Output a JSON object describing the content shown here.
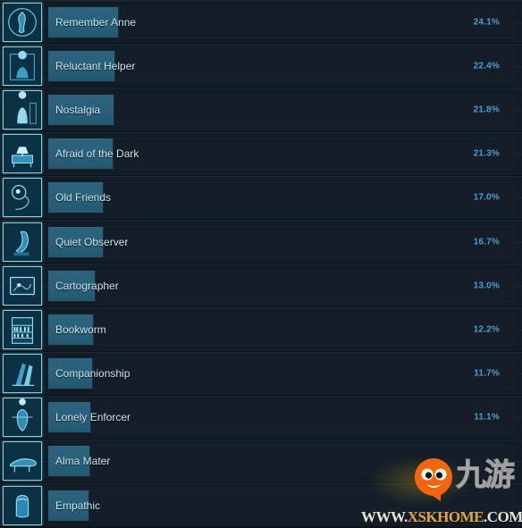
{
  "chart_data": {
    "type": "bar",
    "title": "",
    "xlabel": "",
    "ylabel": "",
    "xlim": [
      0,
      100
    ],
    "categories": [
      "Remember Anne",
      "Reluctant Helper",
      "Nostalgia",
      "Afraid of the Dark",
      "Old Friends",
      "Quiet Observer",
      "Cartographer",
      "Bookworm",
      "Companionship",
      "Lonely Enforcer",
      "Alma Mater",
      "Empathic"
    ],
    "values": [
      24.1,
      22.4,
      21.8,
      21.3,
      17.0,
      16.7,
      13.0,
      12.2,
      11.7,
      11.1,
      10.7,
      10.2
    ],
    "value_labels": [
      "24.1%",
      "22.4%",
      "21.8%",
      "21.3%",
      "17.0%",
      "16.7%",
      "13.0%",
      "12.2%",
      "11.7%",
      "11.1%",
      "",
      ""
    ],
    "orientation": "horizontal",
    "grid": false,
    "legend": null
  },
  "rows": [
    {
      "name": "Remember Anne",
      "percent": "24.1%",
      "fill": 24.1,
      "icon": "figure-circle-icon"
    },
    {
      "name": "Reluctant Helper",
      "percent": "22.4%",
      "fill": 22.4,
      "icon": "person-doorway-icon"
    },
    {
      "name": "Nostalgia",
      "percent": "21.8%",
      "fill": 21.8,
      "icon": "child-silhouette-icon"
    },
    {
      "name": "Afraid of the Dark",
      "percent": "21.3%",
      "fill": 21.3,
      "icon": "bed-lamp-icon"
    },
    {
      "name": "Old Friends",
      "percent": "17.0%",
      "fill": 17.0,
      "icon": "head-wire-icon"
    },
    {
      "name": "Quiet Observer",
      "percent": "16.7%",
      "fill": 16.7,
      "icon": "standing-figure-icon"
    },
    {
      "name": "Cartographer",
      "percent": "13.0%",
      "fill": 13.0,
      "icon": "map-icon"
    },
    {
      "name": "Bookworm",
      "percent": "12.2%",
      "fill": 12.2,
      "icon": "bookshelf-icon"
    },
    {
      "name": "Companionship",
      "percent": "11.7%",
      "fill": 11.7,
      "icon": "two-figures-icon"
    },
    {
      "name": "Lonely Enforcer",
      "percent": "11.1%",
      "fill": 11.1,
      "icon": "officer-icon"
    },
    {
      "name": "Alma Mater",
      "percent": "",
      "fill": 10.7,
      "icon": "bench-icon"
    },
    {
      "name": "Empathic",
      "percent": "",
      "fill": 10.2,
      "icon": "hooded-figure-icon"
    }
  ],
  "watermark": {
    "cn_label": "九游",
    "url_prefix": "WWW.",
    "url_highlight": "XSKHOME",
    "url_suffix": ".COM"
  },
  "colors": {
    "background": "#131c26",
    "bar_fill": "#2c637f",
    "percent_text": "#4a9fd0",
    "label_text": "#cfe3ef",
    "icon_border": "#7fd4e8",
    "watermark_orange": "#f4650d"
  }
}
